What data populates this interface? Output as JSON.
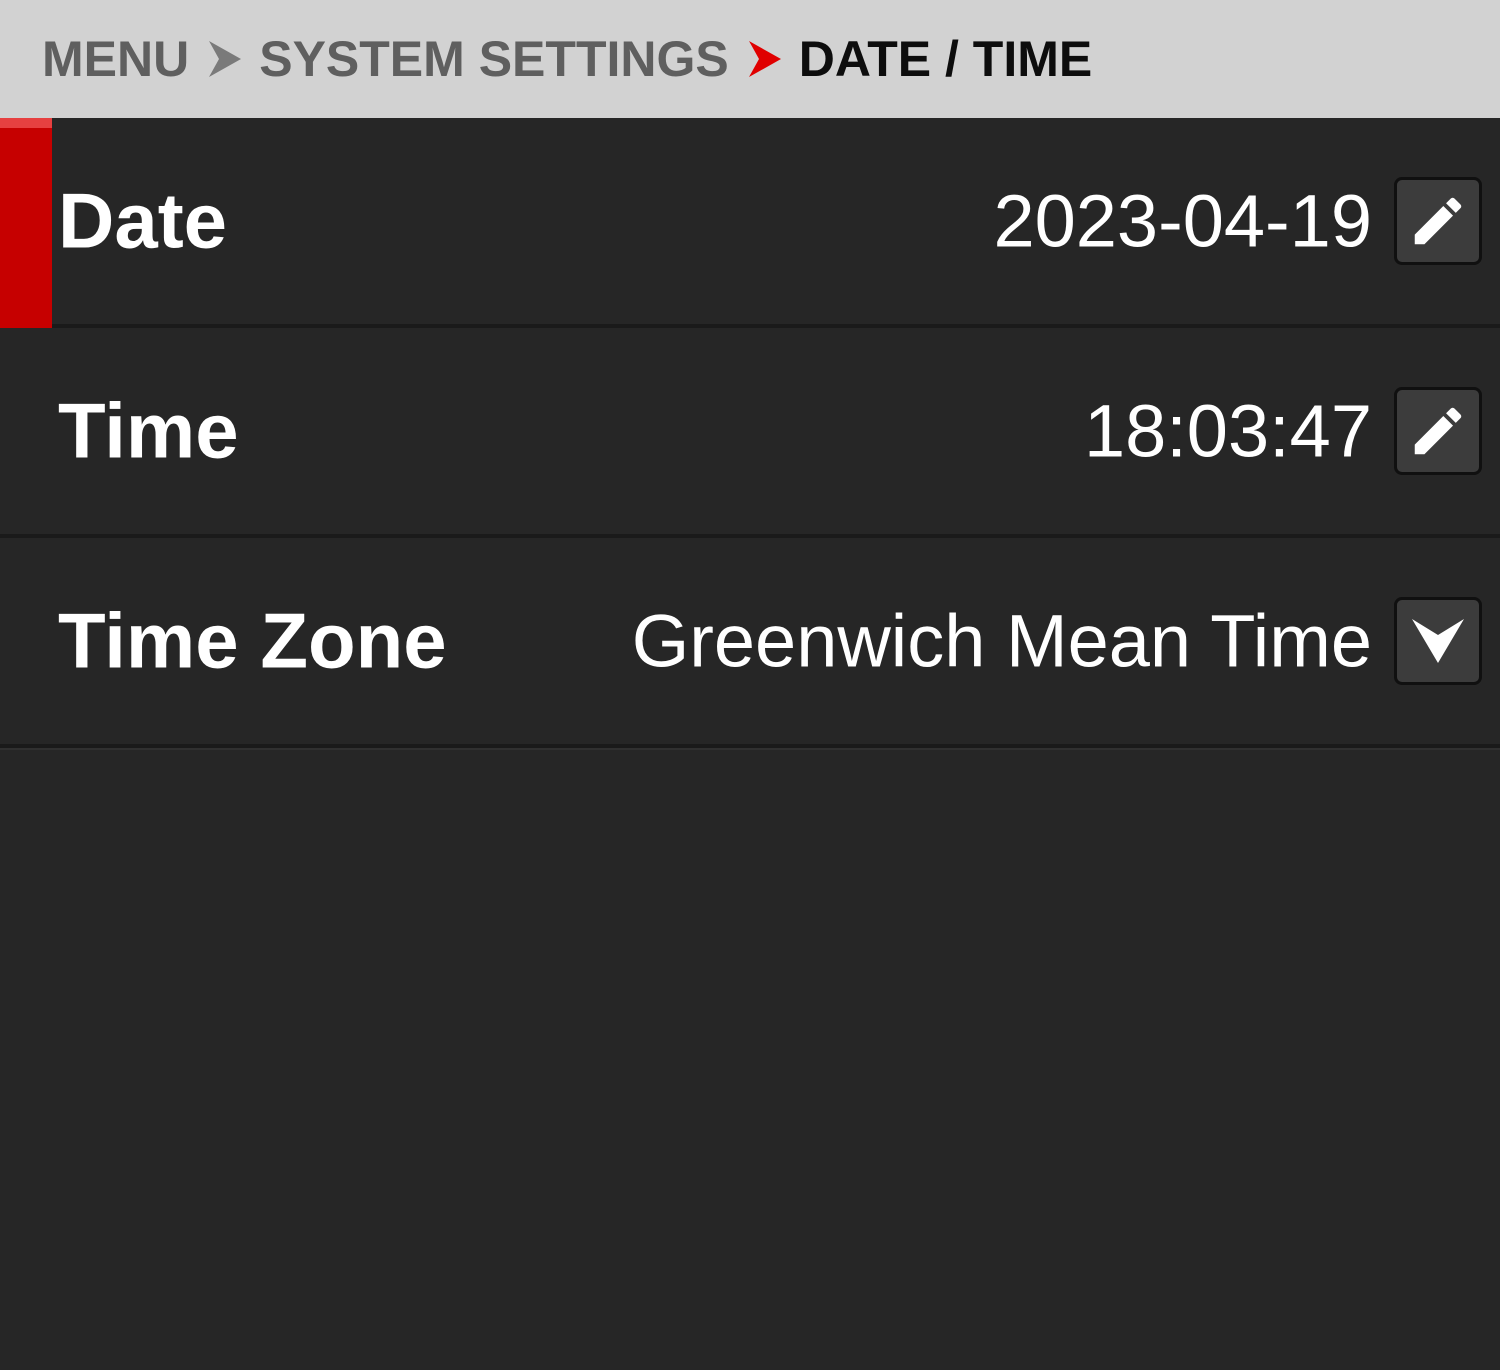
{
  "breadcrumb": {
    "items": [
      "MENU",
      "SYSTEM SETTINGS",
      "DATE / TIME"
    ],
    "separator_colors": [
      "#7a7a7a",
      "#e00000"
    ]
  },
  "settings": {
    "rows": [
      {
        "label": "Date",
        "value": "2023-04-19",
        "control": "pencil-icon",
        "selected": true
      },
      {
        "label": "Time",
        "value": "18:03:47",
        "control": "pencil-icon",
        "selected": false
      },
      {
        "label": "Time Zone",
        "value": "Greenwich Mean Time",
        "control": "dropdown-arrow-icon",
        "selected": false
      }
    ]
  },
  "colors": {
    "background": "#262626",
    "header_background": "#d2d2d2",
    "selection_accent": "#c60000",
    "text": "#ffffff"
  }
}
